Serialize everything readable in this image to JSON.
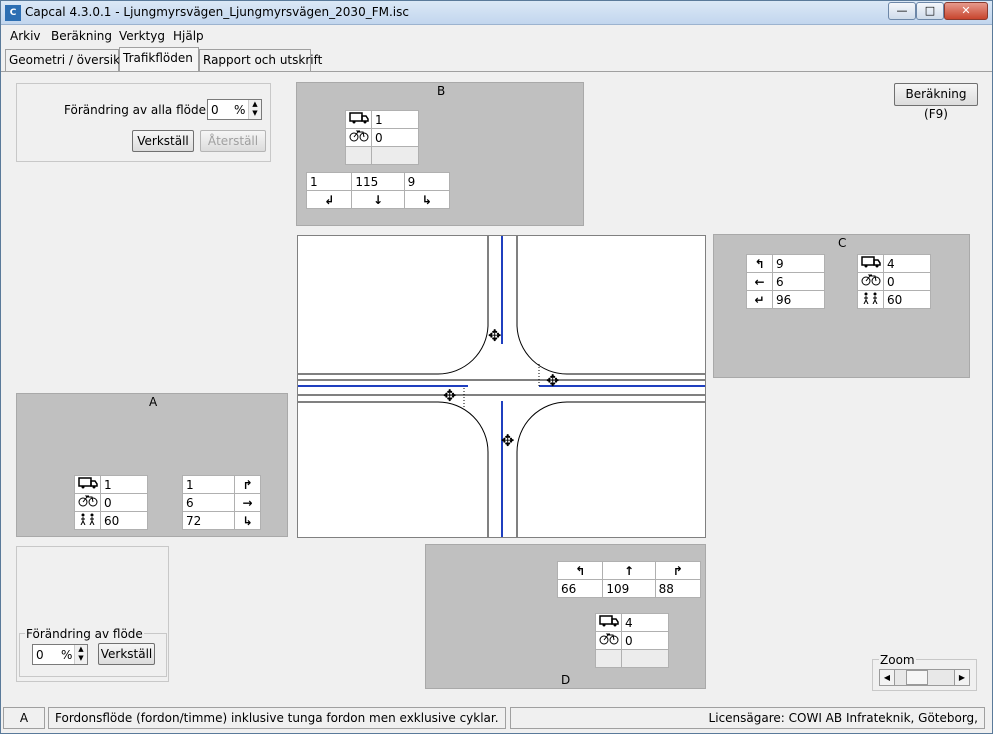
{
  "window": {
    "title": "Capcal 4.3.0.1 - Ljungmyrsvägen_Ljungmyrsvägen_2030_FM.isc",
    "app_icon": "capcal-app-icon",
    "controls": [
      "minimize",
      "maximize",
      "close"
    ]
  },
  "menu": [
    "Arkiv",
    "Beräkning",
    "Verktyg",
    "Hjälp"
  ],
  "tabs": [
    {
      "label": "Geometri / översikt",
      "active": false
    },
    {
      "label": "Trafikflöden",
      "active": true
    },
    {
      "label": "Rapport och utskrift",
      "active": false
    }
  ],
  "global_change": {
    "label": "Förändring av alla flöden:",
    "value": "0",
    "unit": "%",
    "apply": "Verkställ",
    "reset": "Återställ"
  },
  "calc_button": "Beräkning (F9)",
  "approach_a": {
    "label": "A",
    "truck": "1",
    "bike": "0",
    "ped": "60",
    "turns": [
      {
        "value": "1",
        "icon": "turn-left-arrow-icon"
      },
      {
        "value": "6",
        "icon": "straight-right-arrow-icon"
      },
      {
        "value": "72",
        "icon": "turn-right-arrow-icon"
      }
    ]
  },
  "approach_b": {
    "label": "B",
    "truck": "1",
    "bike": "0",
    "turns": [
      {
        "value": "1",
        "icon": "turn-left-arrow-icon"
      },
      {
        "value": "115",
        "icon": "straight-down-arrow-icon"
      },
      {
        "value": "9",
        "icon": "turn-right-arrow-icon"
      }
    ]
  },
  "approach_c": {
    "label": "C",
    "truck": "4",
    "bike": "0",
    "ped": "60",
    "turns": [
      {
        "value": "9",
        "icon": "turn-right-arrow-icon"
      },
      {
        "value": "6",
        "icon": "straight-left-arrow-icon"
      },
      {
        "value": "96",
        "icon": "turn-left-arrow-icon"
      }
    ]
  },
  "approach_d": {
    "label": "D",
    "truck": "4",
    "bike": "0",
    "turns": [
      {
        "value": "66",
        "icon": "turn-left-arrow-icon"
      },
      {
        "value": "109",
        "icon": "straight-up-arrow-icon"
      },
      {
        "value": "88",
        "icon": "turn-right-arrow-icon"
      }
    ]
  },
  "flow_change": {
    "legend": "Förändring av flöde",
    "value": "0",
    "unit": "%",
    "apply": "Verkställ"
  },
  "zoom": {
    "legend": "Zoom"
  },
  "statusbar": {
    "approach": "A",
    "message": "Fordonsflöde (fordon/timme) inklusive tunga fordon men exklusive cyklar.",
    "license": "Licensägare: COWI AB Infrateknik, Göteborg,"
  },
  "icons": {
    "truck": "truck-icon",
    "bike": "bicycle-icon",
    "ped": "pedestrian-icon"
  },
  "colors": {
    "road_centerline": "#1f3fbf",
    "panel_bg": "#c0c0c0"
  }
}
